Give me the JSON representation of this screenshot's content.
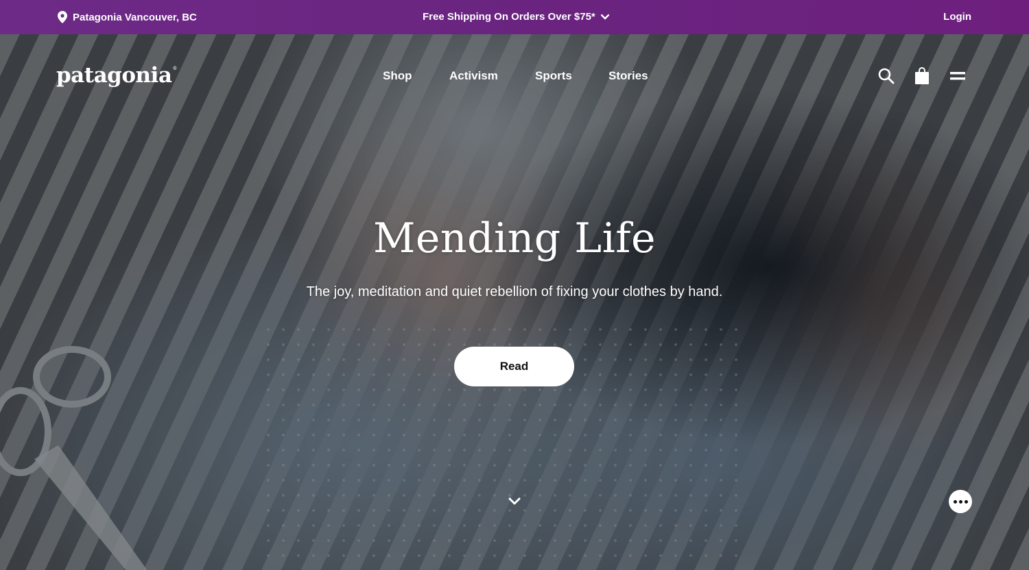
{
  "promo": {
    "location": "Patagonia Vancouver, BC",
    "shipping": "Free Shipping On Orders Over $75*",
    "login": "Login"
  },
  "header": {
    "logo": "patagonia",
    "logo_mark": "®",
    "nav": [
      "Shop",
      "Activism",
      "Sports",
      "Stories"
    ],
    "icons": [
      "search-icon",
      "shopping-bag-icon",
      "menu-icon"
    ]
  },
  "hero": {
    "title": "Mending Life",
    "subtitle": "The joy, meditation and quiet rebellion of fixing your clothes by hand.",
    "cta": "Read"
  },
  "colors": {
    "promo_bar": "#6a2480",
    "text": "#ffffff",
    "button_bg": "#ffffff",
    "button_text": "#111111"
  }
}
